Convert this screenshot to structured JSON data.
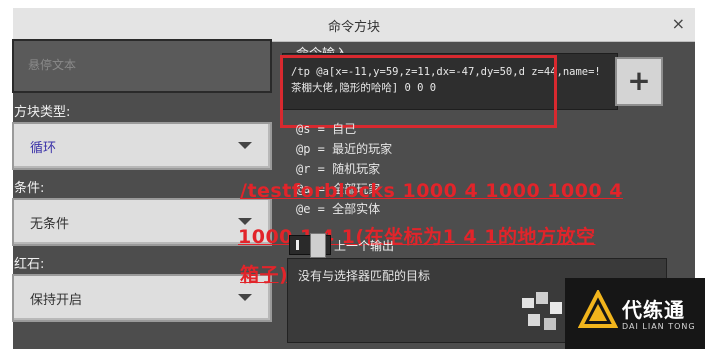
{
  "window": {
    "title": "命令方块",
    "close": "×"
  },
  "left": {
    "hover_text_placeholder": "悬停文本",
    "block_type_label": "方块类型:",
    "block_type_value": "循环",
    "condition_label": "条件:",
    "condition_value": "无条件",
    "redstone_label": "红石:",
    "redstone_value": "保持开启"
  },
  "right": {
    "command_input_label": "命令输入",
    "command_text": "/tp @a[x=-11,y=59,z=11,dx=-47,dy=50,d z=44,name=!茶棚大佬,隐形的哈哈] 0 0 0",
    "plus_label": "+",
    "help_lines": [
      "@s = 自己",
      "@p = 最近的玩家",
      "@r = 随机玩家",
      "@a = 全部玩家",
      "@e = 全部实体"
    ],
    "previous_output_label": "上一个输出",
    "output_text": "没有与选择器匹配的目标"
  },
  "overlay": {
    "line1": "/testforblocks 1000 4 1000 1000 4",
    "line2": "1000 1 4 1(在坐标为1 4 1的地方放空",
    "line3": "箱子)"
  },
  "watermark": {
    "main": "代练通",
    "sub": "DAI LIAN TONG"
  },
  "colors": {
    "annotation_red": "#d8292f",
    "panel_dark": "#4d4d4d",
    "title_bar": "#e4e4e4",
    "block_type_text": "#3b32a8"
  }
}
